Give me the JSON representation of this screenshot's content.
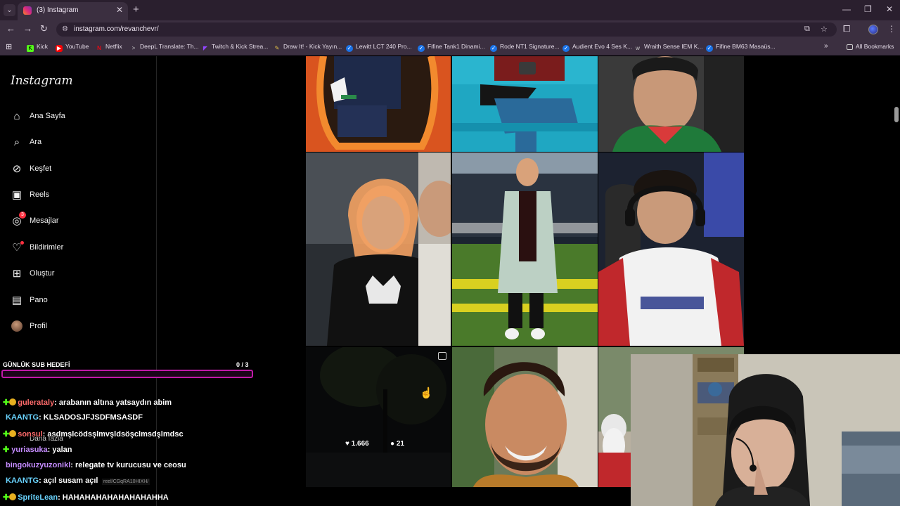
{
  "browser": {
    "tab_title": "(3) Instagram",
    "url": "instagram.com/revanchevr/",
    "bookmarks": [
      {
        "label": "Kick",
        "color": "#53fc18"
      },
      {
        "label": "YouTube",
        "color": "#ff0000"
      },
      {
        "label": "Netflix",
        "color": "#e50914"
      },
      {
        "label": "DeepL Translate: Th...",
        "color": "#0f2b46"
      },
      {
        "label": "Twitch & Kick Strea...",
        "color": "#9146ff"
      },
      {
        "label": "Draw It! - Kick Yayın...",
        "color": "#e8c547"
      },
      {
        "label": "Lewitt LCT 240 Pro...",
        "color": "#1a73e8"
      },
      {
        "label": "Fifine Tank1 Dinami...",
        "color": "#1a73e8"
      },
      {
        "label": "Rode NT1 Signature...",
        "color": "#1a73e8"
      },
      {
        "label": "Audient Evo 4 Ses K...",
        "color": "#1a73e8"
      },
      {
        "label": "Wraith Sense IEM K...",
        "color": "#cccccc"
      },
      {
        "label": "Fifine BM63 Masaüs...",
        "color": "#1a73e8"
      }
    ],
    "all_bookmarks": "All Bookmarks"
  },
  "sidebar": {
    "logo": "Instagram",
    "items": [
      {
        "label": "Ana Sayfa",
        "icon": "home-icon"
      },
      {
        "label": "Ara",
        "icon": "search-icon"
      },
      {
        "label": "Keşfet",
        "icon": "compass-icon"
      },
      {
        "label": "Reels",
        "icon": "reels-icon"
      },
      {
        "label": "Mesajlar",
        "icon": "messenger-icon",
        "badge": "3"
      },
      {
        "label": "Bildirimler",
        "icon": "heart-icon"
      },
      {
        "label": "Oluştur",
        "icon": "plus-square-icon"
      },
      {
        "label": "Pano",
        "icon": "dashboard-icon"
      },
      {
        "label": "Profil",
        "icon": "profile-avatar"
      }
    ],
    "more": "Daha fazla"
  },
  "post_hover": {
    "likes": "1.666",
    "comments": "21",
    "link_preview": "reel/CGqRA10HIXH/"
  },
  "overlay": {
    "sub_goal_title": "GÜNLÜK SUB HEDEFİ",
    "sub_goal_value": "0 / 3",
    "sub_goal_progress": 0,
    "chat": [
      {
        "user": "gulerataly",
        "user_color": "#ff6b6b",
        "text": ": arabanın altına yatsaydın abim"
      },
      {
        "user": "KAANTG",
        "user_color": "#6ad4ff",
        "text": ": KLSADOSJFJSDFMSASDF"
      },
      {
        "user": "sonsul",
        "user_color": "#ff6b6b",
        "text": ": asdmşlcödsşlmvşldsöşclmsdşlmdsc"
      },
      {
        "user": "yuriasuka",
        "user_color": "#c58cff",
        "text": ": yalan"
      },
      {
        "user": "bingokuzyuzonikl",
        "user_color": "#c58cff",
        "text": ": relegate tv kurucusu ve ceosu"
      },
      {
        "user": "KAANTG",
        "user_color": "#6ad4ff",
        "text": ": açıl susam açıl"
      },
      {
        "user": "SpriteLean",
        "user_color": "#6ad4ff",
        "text": ": HAHAHAHAHAHAHAHAHHA"
      }
    ]
  }
}
